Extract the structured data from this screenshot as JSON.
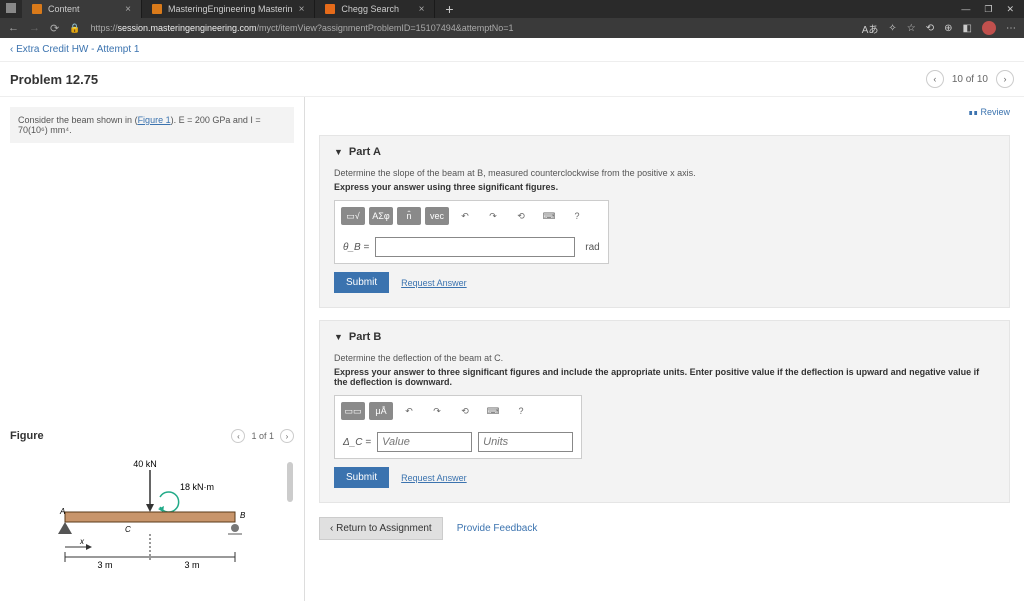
{
  "browser": {
    "tabs": [
      {
        "label": "Content"
      },
      {
        "label": "MasteringEngineering Masterin"
      },
      {
        "label": "Chegg Search"
      }
    ],
    "url_prefix": "https://",
    "url_domain": "session.masteringengineering.com",
    "url_path": "/myct/itemView?assignmentProblemID=15107494&attemptNo=1"
  },
  "breadcrumb": "Extra Credit HW - Attempt 1",
  "problem": {
    "title": "Problem 12.75",
    "pager": "10 of 10"
  },
  "left": {
    "consider_prefix": "Consider the beam shown in (",
    "figure_link": "Figure 1",
    "consider_suffix": "). E = 200 GPa and I = 70(10⁶) mm⁴.",
    "figure_label": "Figure",
    "figure_pager": "1 of 1",
    "beam": {
      "force_label": "40 kN",
      "moment_label": "18 kN·m",
      "span_left": "3 m",
      "span_right": "3 m",
      "x_label": "x",
      "A_label": "A",
      "B_label": "B",
      "C_label": "C"
    }
  },
  "review_label": "Review",
  "partA": {
    "title": "Part A",
    "prompt": "Determine the slope of the beam at B, measured counterclockwise from the positive x axis.",
    "instr": "Express your answer using three significant figures.",
    "var": "θ_B =",
    "unit": "rad",
    "submit": "Submit",
    "request": "Request Answer",
    "tool_sigma": "ΑΣφ",
    "tool_vec": "vec"
  },
  "partB": {
    "title": "Part B",
    "prompt": "Determine the deflection of the beam at C.",
    "instr": "Express your answer to three significant figures and include the appropriate units. Enter positive value if the deflection is upward and negative value if the deflection is downward.",
    "var": "Δ_C =",
    "value_ph": "Value",
    "units_ph": "Units",
    "submit": "Submit",
    "request": "Request Answer"
  },
  "footer": {
    "return": "Return to Assignment",
    "feedback": "Provide Feedback"
  }
}
